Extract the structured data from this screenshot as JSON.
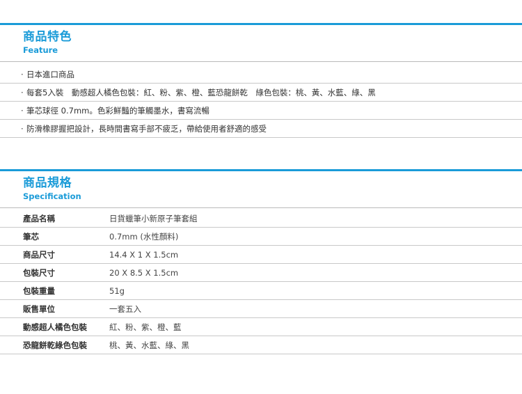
{
  "feature": {
    "title": "商品特色",
    "subtitle": "Feature",
    "items": [
      "日本進口商品",
      "每套5入裝　動感超人橘色包裝：紅、粉、紫、橙、藍恐龍餅乾　綠色包裝：桃、黃、水藍、綠、黑",
      "筆芯球徑 0.7mm。色彩鮮豔的筆觸墨水，書寫流暢",
      "防滑橡膠握把設計，長時間書寫手部不疲乏，帶給使用者舒適的感受"
    ]
  },
  "spec": {
    "title": "商品規格",
    "subtitle": "Specification",
    "rows": [
      {
        "key": "產品名稱",
        "value": "日貨蠟筆小新原子筆套組"
      },
      {
        "key": "筆芯",
        "value": "0.7mm (水性顏料)"
      },
      {
        "key": "商品尺寸",
        "value": "14.4 X 1 X 1.5cm"
      },
      {
        "key": "包裝尺寸",
        "value": "20 X 8.5 X 1.5cm"
      },
      {
        "key": "包裝重量",
        "value": "51g"
      },
      {
        "key": "販售單位",
        "value": "一套五入"
      },
      {
        "key": "動感超人橘色包裝",
        "value": "紅、粉、紫、橙、藍"
      },
      {
        "key": "恐龍餅乾綠色包裝",
        "value": "桃、黃、水藍、綠、黑"
      }
    ]
  },
  "colors": {
    "accent": "#1a9bd8",
    "divider": "#c8c8c8"
  }
}
